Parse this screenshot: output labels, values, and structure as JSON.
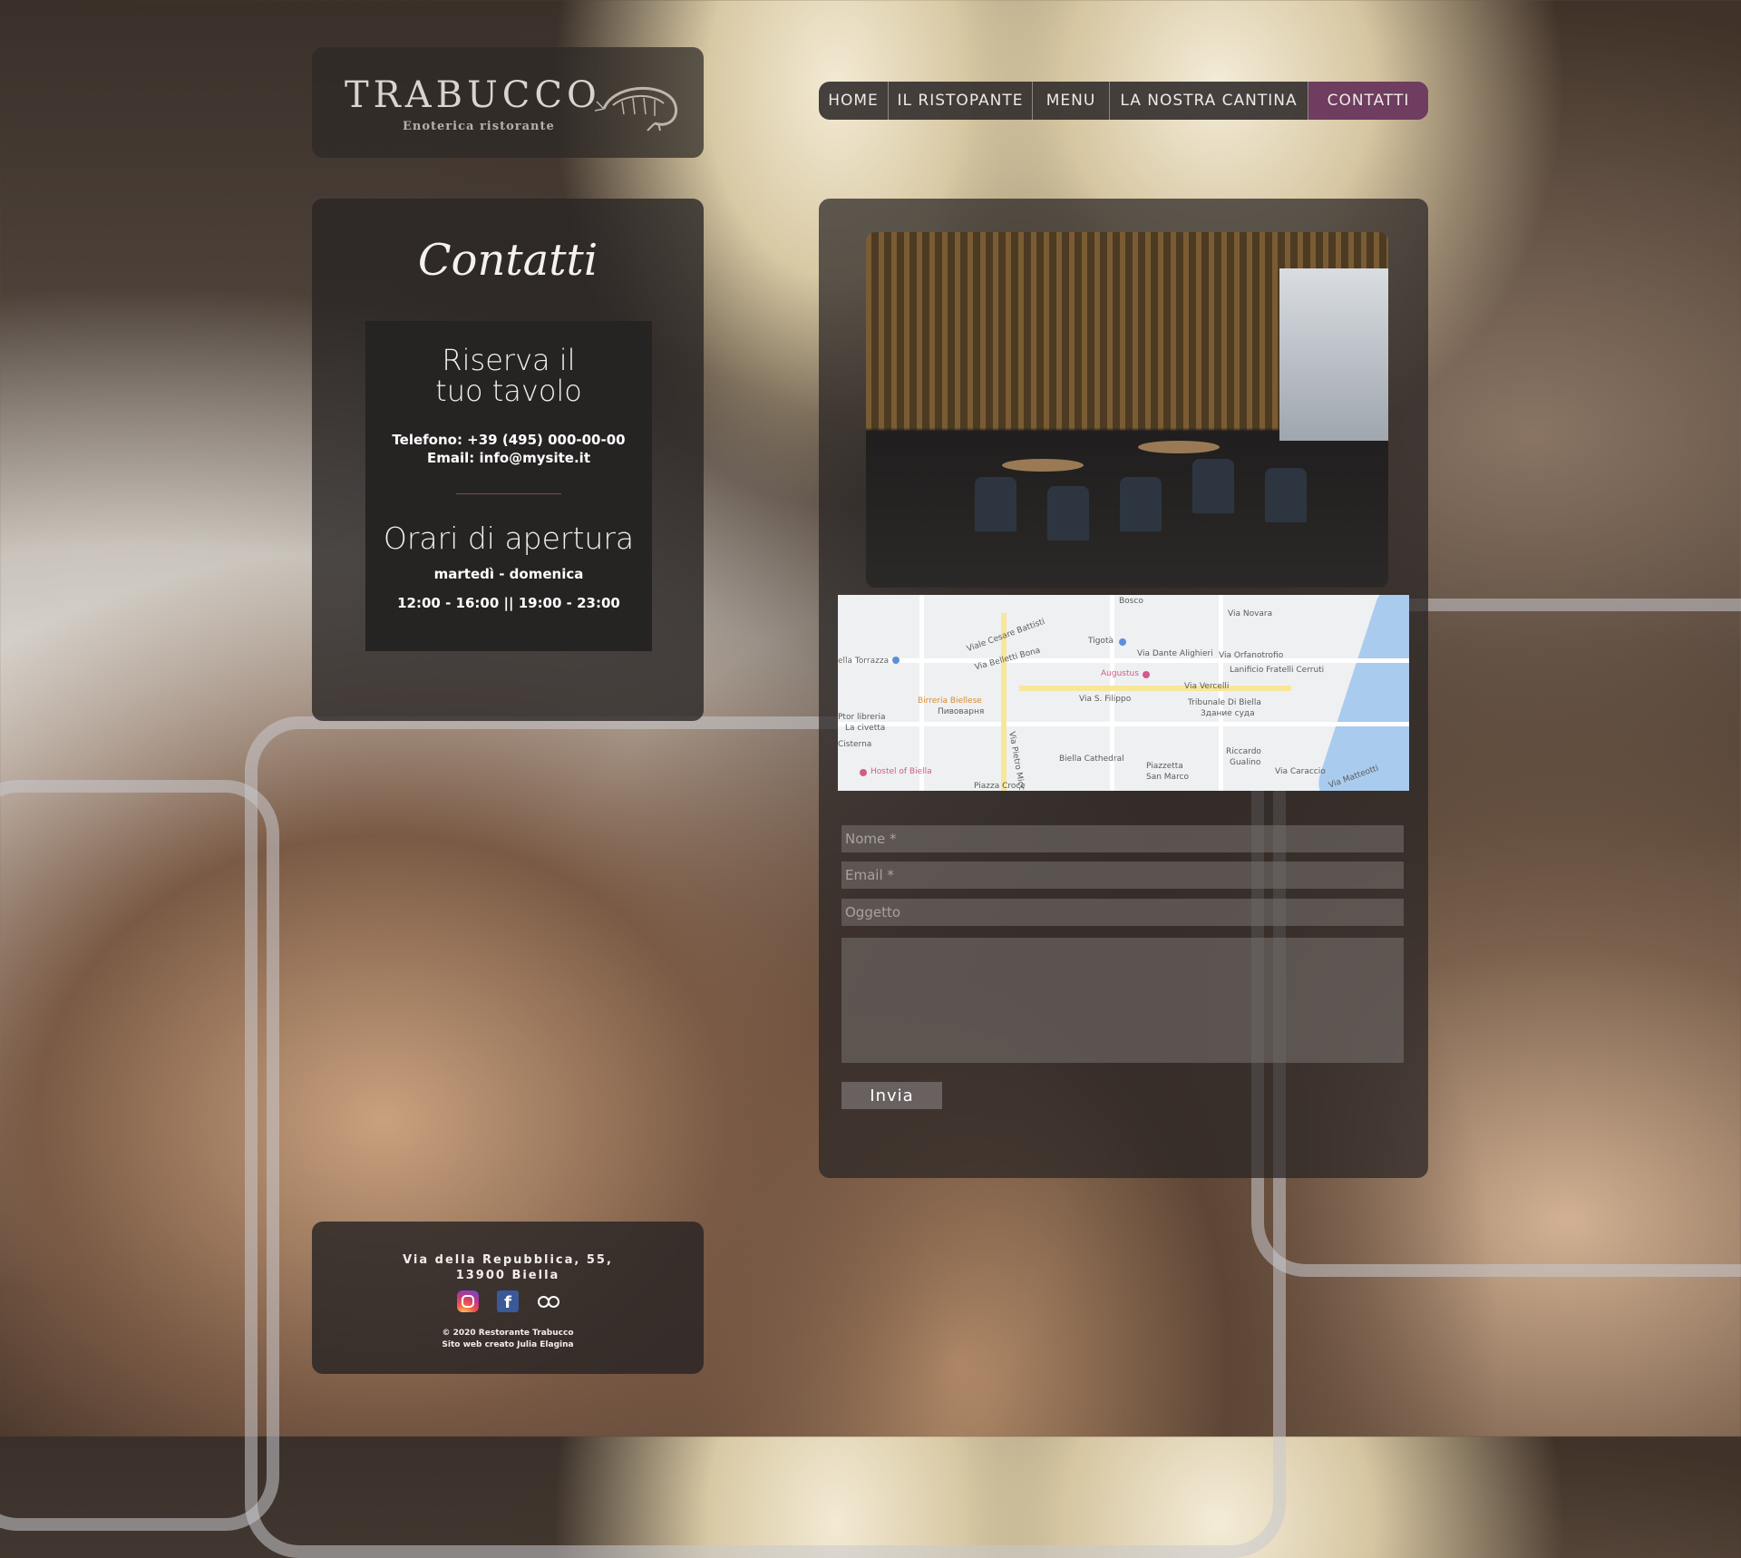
{
  "logo": {
    "title": "TRABUCCO",
    "subtitle": "Enoterica ristorante"
  },
  "nav": {
    "items": [
      {
        "label": "HOME",
        "active": false
      },
      {
        "label": "IL RISTOPANTE",
        "active": false
      },
      {
        "label": "MENU",
        "active": false
      },
      {
        "label": "LA NOSTRA CANTINA",
        "active": false
      },
      {
        "label": "CONTATTI",
        "active": true
      }
    ],
    "active_color": "#6e3d60"
  },
  "contact": {
    "title": "Contatti",
    "reserve_line1": "Riserva il",
    "reserve_line2": "tuo tavolo",
    "phone": "Telefono:  +39 (495) 000-00-00",
    "email": "Email:  info@mysite.it",
    "hours_title": "Orari di apertura",
    "days": "martedì - domenica",
    "times": "12:00 - 16:00 || 19:00 - 23:00"
  },
  "map": {
    "labels": {
      "bosco": "Bosco",
      "via_novara": "Via Novara",
      "tigota": "Tigotà",
      "via_dante": "Via Dante Alighieri",
      "via_orfanotrofio": "Via Orfanotrofio",
      "lanificio": "Lanificio Fratelli Cerruti",
      "torrazza": "ella Torrazza",
      "augustus": "Augustus",
      "via_vercelli": "Via Vercelli",
      "via_s_filippo": "Via S. Filippo",
      "tribunale": "Tribunale Di Biella",
      "tribunale_sub": "Здание суда",
      "birreria": "Birreria Biellese",
      "birreria_sub": "Пивоварня",
      "libreria": "Ptor libreria",
      "civetta": "La civetta",
      "cisterna": "Cisterna",
      "cathedral": "Biella Cathedral",
      "riccardo": "Riccardo",
      "gualino": "Gualino",
      "hostel": "Hostel of Biella",
      "piazzetta": "Piazzetta",
      "san_marco": "San Marco",
      "piazza_croce": "Piazza Croce",
      "via_caraccio": "Via Caraccio",
      "via_pietro": "Via Pietro Micca",
      "viale_cesare": "Viale Cesare Battisti",
      "via_belletti": "Via Belletti Bona",
      "via_matteotti": "Via Matteotti"
    }
  },
  "form": {
    "name_placeholder": "Nome *",
    "email_placeholder": "Email *",
    "subject_placeholder": "Oggetto",
    "message_placeholder": "",
    "submit_label": "Invia"
  },
  "footer": {
    "address_line1": "Via della Repubblica, 55,",
    "address_line2": "13900 Biella",
    "copyright": "© 2020 Restorante Trabucco",
    "credit": "Sito web creato Julia Elagina",
    "social_icons": [
      "instagram-icon",
      "facebook-icon",
      "tripadvisor-icon"
    ]
  }
}
